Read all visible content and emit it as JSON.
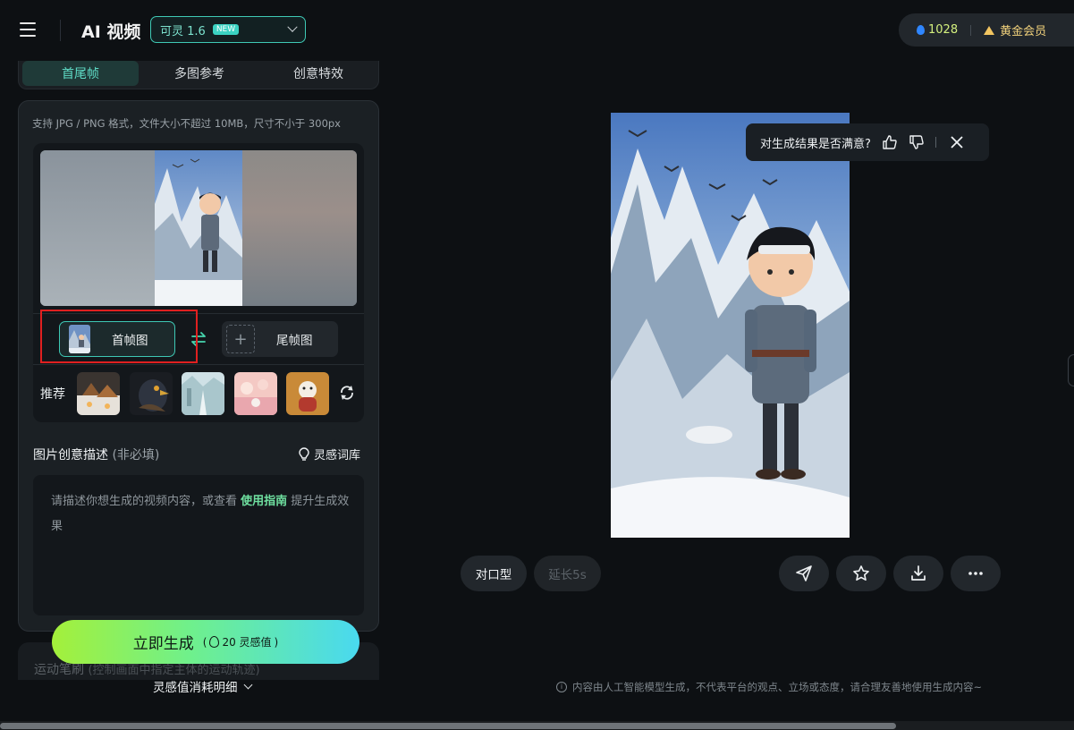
{
  "header": {
    "app_title": "AI 视频",
    "model": "可灵 1.6",
    "model_badge": "NEW",
    "points": "1028",
    "member": "黄金会员"
  },
  "tabs": [
    {
      "label": "首尾帧",
      "active": true
    },
    {
      "label": "多图参考",
      "active": false
    },
    {
      "label": "创意特效",
      "active": false
    }
  ],
  "upload": {
    "hint": "支持 JPG / PNG 格式，文件大小不超过 10MB，尺寸不小于 300px",
    "first_frame_label": "首帧图",
    "end_frame_label": "尾帧图",
    "recommend_label": "推荐"
  },
  "description": {
    "title": "图片创意描述",
    "optional": "(非必填)",
    "library_link": "灵感词库",
    "placeholder_before": "请描述你想生成的视频内容，或查看 ",
    "placeholder_link": "使用指南",
    "placeholder_after": " 提升生成效果"
  },
  "motion": {
    "label": "运动笔刷",
    "sub": "(控制画面中指定主体的运动轨迹)"
  },
  "generate": {
    "label": "立即生成",
    "cost_open": "(",
    "cost": "20 灵感值",
    "cost_close": ")",
    "detail": "灵感值消耗明细"
  },
  "feedback": {
    "question": "对生成结果是否满意?"
  },
  "actions": {
    "lip_sync": "对口型",
    "extend": "延长5s"
  },
  "notice": "内容由人工智能模型生成，不代表平台的观点、立场或态度，请合理友善地使用生成内容~",
  "icons": [
    "menu-icon",
    "chevron-down-icon",
    "droplet-icon",
    "crown-icon",
    "swap-icon",
    "plus-icon",
    "refresh-icon",
    "lightbulb-icon",
    "flame-icon",
    "thumbs-up-icon",
    "thumbs-down-icon",
    "close-icon",
    "send-icon",
    "star-icon",
    "download-icon",
    "more-icon",
    "info-icon"
  ],
  "colors": {
    "accent": "#3fc9b5",
    "link": "#6fe0a0",
    "highlight_box": "#e02020"
  }
}
